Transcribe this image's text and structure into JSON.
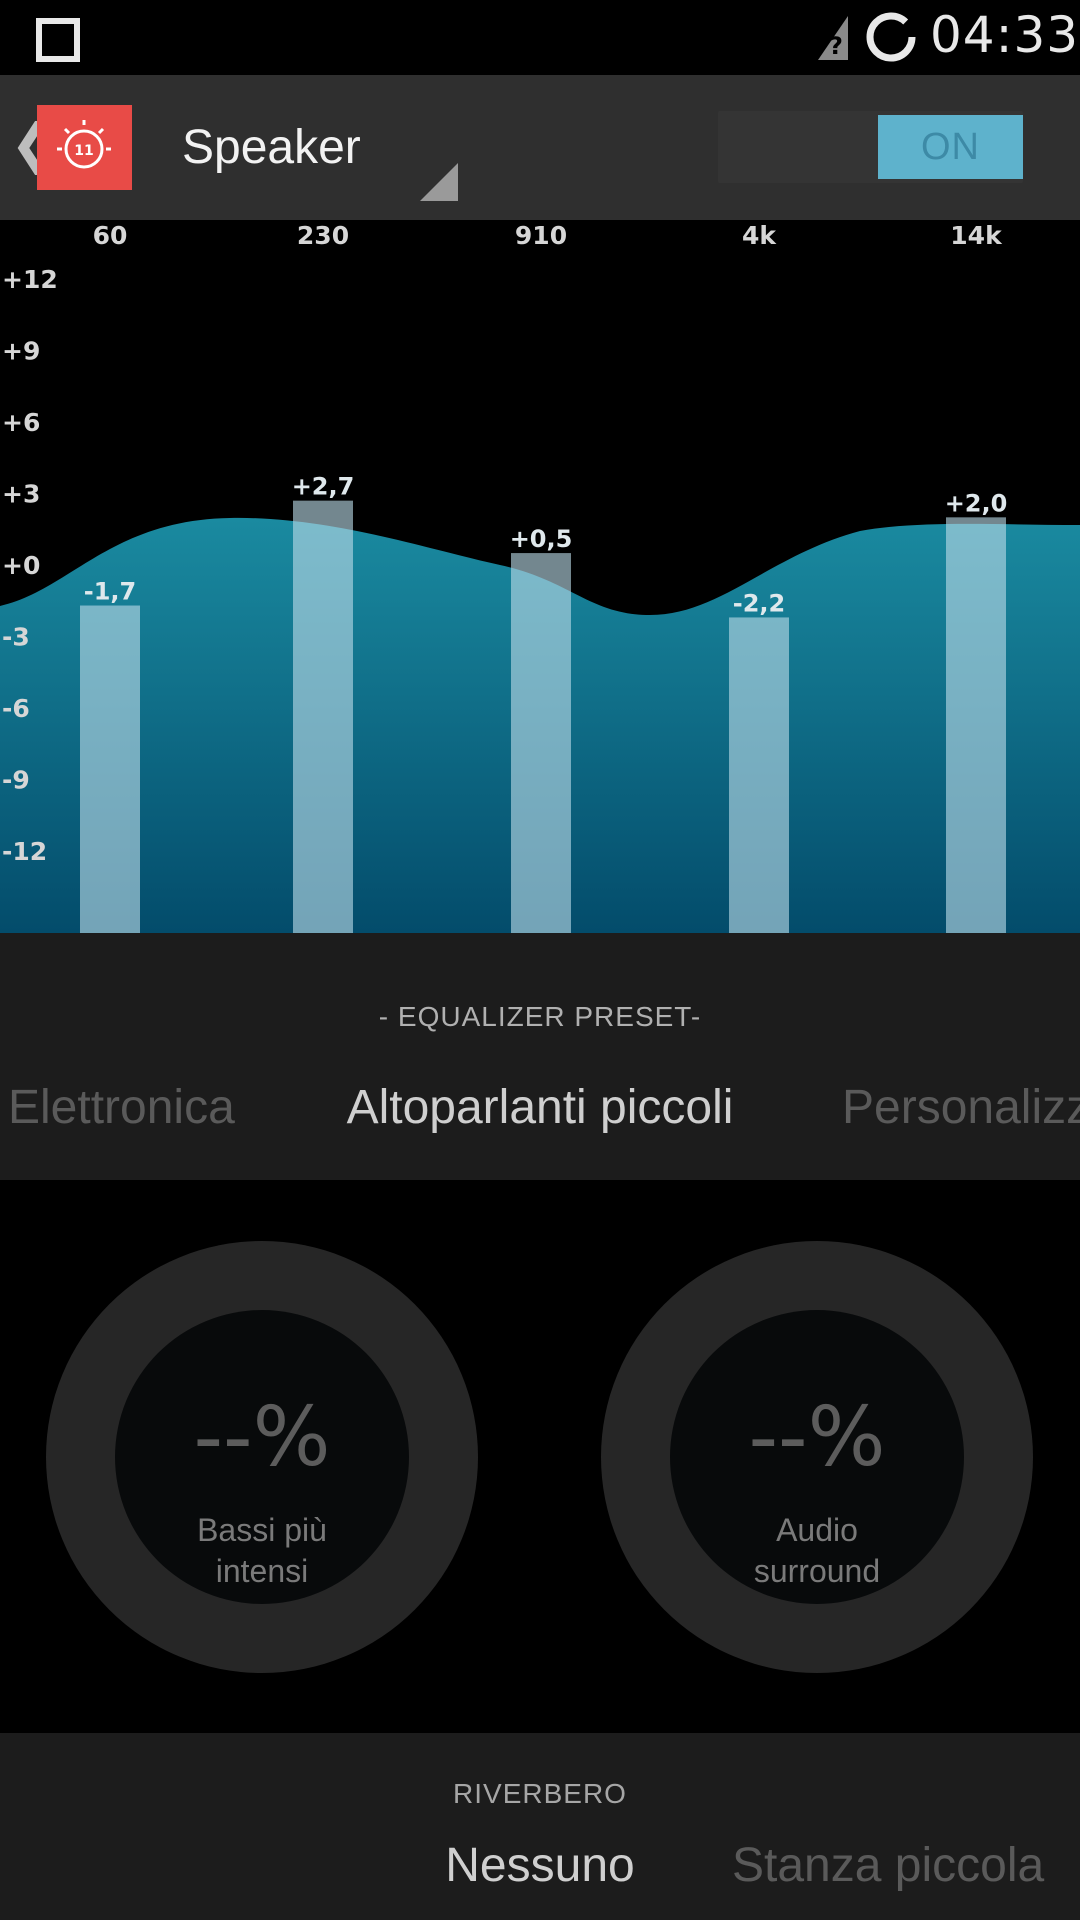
{
  "status_bar": {
    "time": "04:33",
    "icons": [
      "square-icon",
      "signal-unknown-icon",
      "loading-ring-icon"
    ]
  },
  "header": {
    "back_icon": "chevron-left-icon",
    "logo_text": "11",
    "title": "Speaker",
    "toggle_label": "ON",
    "colors": {
      "logo_bg": "#e84b47",
      "toggle_on": "#5eb2cc"
    }
  },
  "chart_data": {
    "type": "bar",
    "categories": [
      "60",
      "230",
      "910",
      "4k",
      "14k"
    ],
    "values": [
      -1.7,
      2.7,
      0.5,
      -2.2,
      2.0
    ],
    "value_labels": [
      "-1,7",
      "+2,7",
      "+0,5",
      "-2,2",
      "+2,0"
    ],
    "y_ticks": [
      "+12",
      "+9",
      "+6",
      "+3",
      "+0",
      "-3",
      "-6",
      "-9",
      "-12"
    ],
    "ylim": [
      -15,
      12
    ],
    "colors": {
      "bar": "#b9dae6",
      "curve_top": "#1a8aa0",
      "curve_bottom": "#034c6b"
    }
  },
  "preset": {
    "title": "- EQUALIZER PRESET-",
    "items": [
      "Elettronica",
      "Altoparlanti piccoli",
      "Personalizz"
    ],
    "selected": "Altoparlanti piccoli"
  },
  "knobs": [
    {
      "value": "--%",
      "label_line1": "Bassi più",
      "label_line2": "intensi"
    },
    {
      "value": "--%",
      "label_line1": "Audio",
      "label_line2": "surround"
    }
  ],
  "reverb": {
    "title": "RIVERBERO",
    "items": [
      "Nessuno",
      "Stanza piccola"
    ],
    "selected": "Nessuno"
  }
}
